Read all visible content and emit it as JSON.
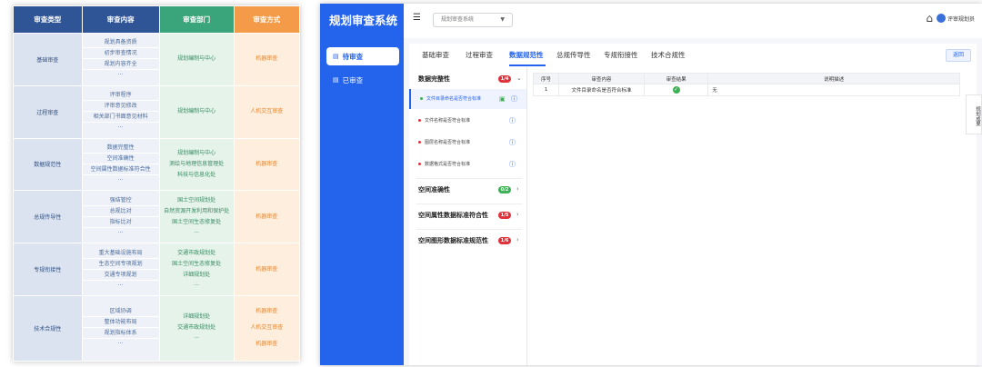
{
  "left_table": {
    "headers": [
      "审查类型",
      "审查内容",
      "审查部门",
      "审查方式"
    ],
    "rows": [
      {
        "type": "基础审查",
        "content": [
          "规划具备资质",
          "初步审查情况",
          "规划内容齐全",
          "···"
        ],
        "dept": [
          "规划编制与中心"
        ],
        "method": [
          "机器审查"
        ]
      },
      {
        "type": "过程审查",
        "content": [
          "评审程序",
          "评审意见修改",
          "相关部门书面意见材料",
          "···"
        ],
        "dept": [
          "规划编制与中心"
        ],
        "method": [
          "人机交互审查"
        ]
      },
      {
        "type": "数据规范性",
        "content": [
          "数据完整性",
          "空间准确性",
          "空间属性数据标准符合性",
          "···"
        ],
        "dept": [
          "规划编制与中心",
          "测绘与地理信息管理处",
          "科技与信息化处"
        ],
        "method": [
          "机器审查"
        ]
      },
      {
        "type": "总规传导性",
        "content": [
          "强结管控",
          "总规比对",
          "指标比对",
          "···"
        ],
        "dept": [
          "国土空间规划处",
          "自然资源开发利用和保护处",
          "国土空间生态修复处",
          "···"
        ],
        "method": [
          "机器审查"
        ]
      },
      {
        "type": "专规衔接性",
        "content": [
          "重大基础设施布局",
          "生态空间专项规划",
          "交通专项规划",
          "···"
        ],
        "dept": [
          "交通市政规划处",
          "国土空间生态修复处",
          "详细规划处",
          "···"
        ],
        "method": [
          "机器审查"
        ]
      },
      {
        "type": "技术合规性",
        "content": [
          "区域协调",
          "整体功能布局",
          "规划指标体系",
          "···"
        ],
        "dept": [
          "详细规划处",
          "交通市政规划处",
          "···"
        ],
        "method": [
          "机器审查",
          "人机交互审查",
          "机器审查"
        ]
      }
    ]
  },
  "app": {
    "title": "规划审查系统",
    "sidebar": {
      "items": [
        {
          "label": "待审查",
          "icon": "doc-icon"
        },
        {
          "label": "已审查",
          "icon": "doc-icon"
        }
      ]
    },
    "topbar": {
      "select_value": "规划审查系统",
      "user_name": "评审规划员"
    },
    "tabs": [
      "基础审查",
      "过程审查",
      "数据规范性",
      "总规传导性",
      "专规衔接性",
      "技术合规性"
    ],
    "return_label": "返回",
    "groups": [
      {
        "label": "数据完整性",
        "badge": "1/4"
      },
      {
        "label": "空间准确性",
        "badge": "0/2"
      },
      {
        "label": "空间属性数据标准符合性",
        "badge": "1/5"
      },
      {
        "label": "空间图形数据标准规范性",
        "badge": "1/6"
      }
    ],
    "sub_items": [
      "文件目录命名是否符合标准",
      "文件名称是否符合标准",
      "图层名称是否符合标准",
      "数据格式是否符合标准"
    ],
    "result_table": {
      "headers": [
        "序号",
        "审查内容",
        "审查结果",
        "说明描述"
      ],
      "rows": [
        {
          "index": "1",
          "content": "文件目录命名是否符合标准",
          "result": "✓",
          "desc": "无"
        }
      ]
    },
    "drawer_label": "规划成果"
  },
  "colors": {
    "primary_blue": "#2463eb",
    "header_navy": "#2f5597",
    "header_green": "#3aa57a",
    "header_orange": "#f39b48",
    "badge_red": "#e0313b",
    "badge_green": "#3cb054"
  }
}
